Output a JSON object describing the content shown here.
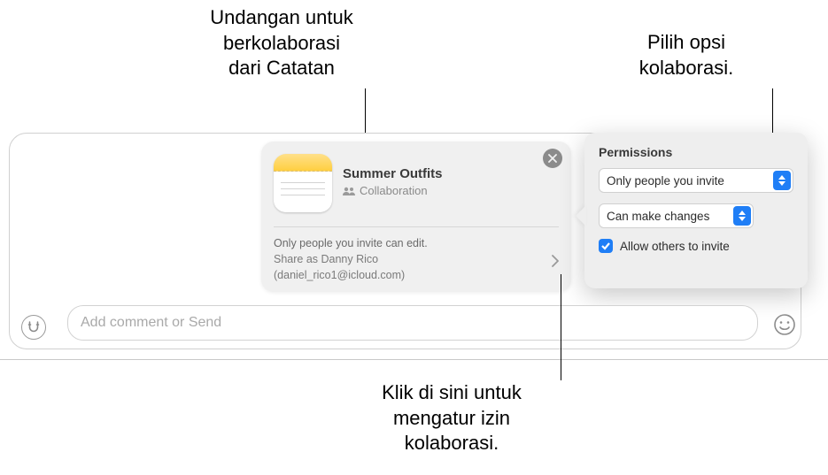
{
  "callouts": {
    "top_left": "Undangan untuk\nberkolaborasi\ndari Catatan",
    "top_right": "Pilih opsi\nkolaborasi.",
    "bottom": "Klik di sini untuk\nmengatur izin\nkolaborasi."
  },
  "invite_card": {
    "title": "Summer Outfits",
    "subtitle": "Collaboration",
    "permission_line": "Only people you invite can edit.",
    "share_as_line": "Share as Danny Rico",
    "email_line": "(daniel_rico1@icloud.com)"
  },
  "popover": {
    "title": "Permissions",
    "select_access": "Only people you invite",
    "select_edit": "Can make changes",
    "checkbox_label": "Allow others to invite"
  },
  "comment": {
    "placeholder": "Add comment or Send"
  }
}
